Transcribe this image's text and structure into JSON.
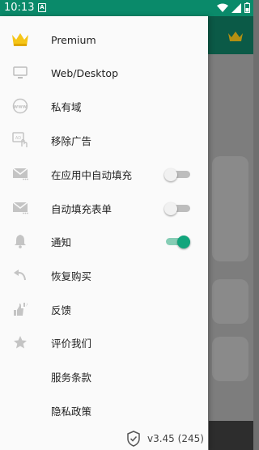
{
  "status_bar": {
    "time": "10:13",
    "notification_letter": "A"
  },
  "drawer": {
    "items": [
      {
        "label": "Premium",
        "icon": "crown-icon"
      },
      {
        "label": "Web/Desktop",
        "icon": "desktop-icon"
      },
      {
        "label": "私有域",
        "icon": "www-globe-icon"
      },
      {
        "label": "移除广告",
        "icon": "ad-block-icon"
      },
      {
        "label": "在应用中自动填充",
        "icon": "mail-icon",
        "toggle": "off"
      },
      {
        "label": "自动填充表单",
        "icon": "mail-icon",
        "toggle": "off"
      },
      {
        "label": "通知",
        "icon": "bell-icon",
        "toggle": "on"
      },
      {
        "label": "恢复购买",
        "icon": "undo-icon"
      },
      {
        "label": "反馈",
        "icon": "thumbs-icon"
      },
      {
        "label": "评价我们",
        "icon": "star-icon"
      },
      {
        "label": "服务条款",
        "icon": ""
      },
      {
        "label": "隐私政策",
        "icon": ""
      }
    ],
    "version": "v3.45 (245)"
  },
  "colors": {
    "primary": "#0a8a6a",
    "accent": "#12a57c",
    "crown": "#f5c518"
  }
}
